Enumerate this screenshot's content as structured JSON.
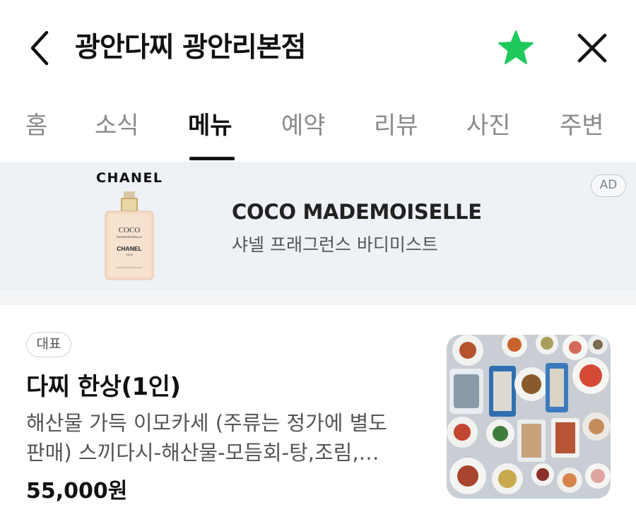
{
  "header": {
    "back_icon": "chevron-left-icon",
    "title": "광안다찌 광안리본점",
    "favorite_icon": "star-icon",
    "favorite_color": "#1ec95b",
    "close_icon": "close-icon"
  },
  "tabs": [
    {
      "label": "홈",
      "active": false
    },
    {
      "label": "소식",
      "active": false
    },
    {
      "label": "메뉴",
      "active": true
    },
    {
      "label": "예약",
      "active": false
    },
    {
      "label": "리뷰",
      "active": false
    },
    {
      "label": "사진",
      "active": false
    },
    {
      "label": "주변",
      "active": false
    }
  ],
  "ad": {
    "brand": "CHANEL",
    "bottle_label_1": "COCO",
    "bottle_label_2": "MADEMOISELLE",
    "bottle_label_3": "CHANEL",
    "bottle_label_4": "PARIS",
    "title": "COCO MADEMOISELLE",
    "subtitle": "샤넬 프래그런스 바디미스트",
    "badge": "AD"
  },
  "menu": {
    "badge": "대표",
    "name": "다찌 한상(1인)",
    "description_line1": "해산물 가득 이모카세 (주류는 정가에 별도",
    "description_line2": "판매) 스끼다시-해산물-모듬회-탕,조림,…",
    "price": "55,000원",
    "photo": "seafood-platter-photo"
  }
}
